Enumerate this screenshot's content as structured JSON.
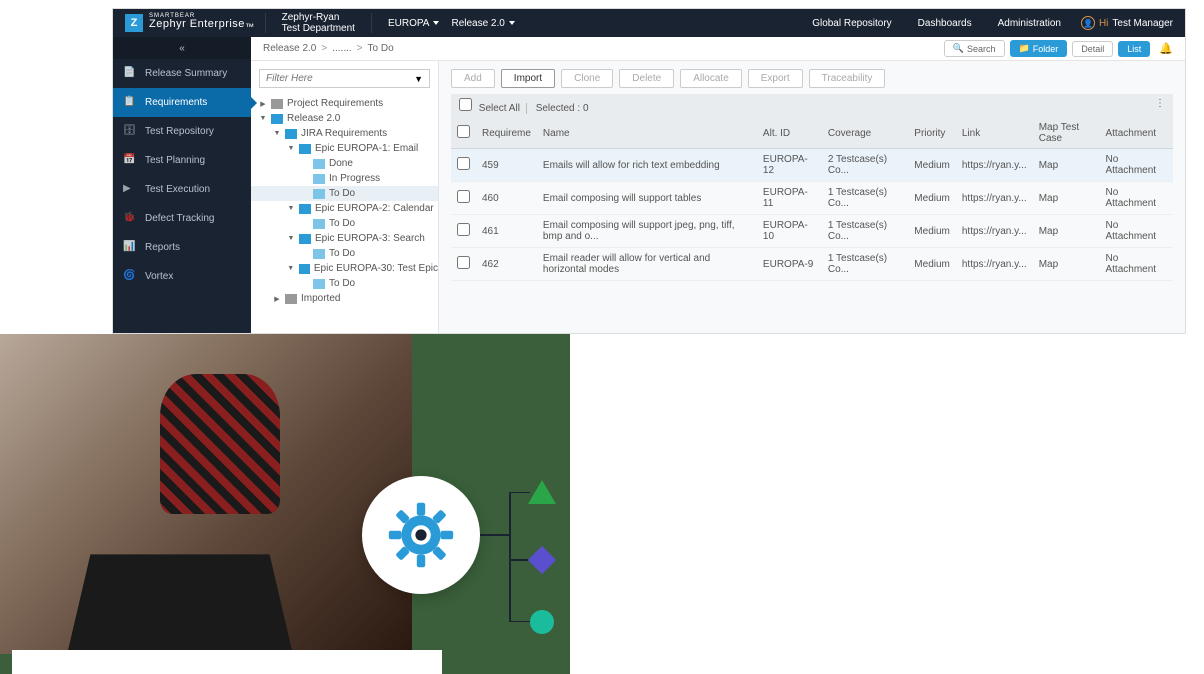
{
  "header": {
    "brand_small": "SMARTBEAR",
    "brand": "Zephyr Enterprise",
    "tm": "™",
    "project_line1": "Zephyr-Ryan",
    "project_line2": "Test Department",
    "nav1": "EUROPA",
    "nav2": "Release 2.0",
    "right": {
      "global": "Global Repository",
      "dash": "Dashboards",
      "admin": "Administration",
      "hi": "Hi",
      "user": "Test Manager"
    }
  },
  "sidebar": {
    "items": [
      {
        "label": "Release Summary",
        "icon": "summary"
      },
      {
        "label": "Requirements",
        "icon": "requirements",
        "active": true
      },
      {
        "label": "Test Repository",
        "icon": "repository"
      },
      {
        "label": "Test Planning",
        "icon": "planning"
      },
      {
        "label": "Test Execution",
        "icon": "execution"
      },
      {
        "label": "Defect Tracking",
        "icon": "defect"
      },
      {
        "label": "Reports",
        "icon": "reports"
      },
      {
        "label": "Vortex",
        "icon": "vortex"
      }
    ]
  },
  "breadcrumb": {
    "a": "Release 2.0",
    "b": ".......",
    "c": "To Do",
    "search": "Search",
    "folder": "Folder",
    "detail": "Detail",
    "list": "List"
  },
  "tree": {
    "filter_placeholder": "Filter Here",
    "n0": "Project Requirements",
    "n1": "Release 2.0",
    "n2": "JIRA Requirements",
    "n3": "Epic EUROPA-1: Email",
    "n3a": "Done",
    "n3b": "In Progress",
    "n3c": "To Do",
    "n4": "Epic EUROPA-2: Calendar",
    "n4a": "To Do",
    "n5": "Epic EUROPA-3: Search",
    "n5a": "To Do",
    "n6": "Epic EUROPA-30: Test Epic",
    "n6a": "To Do",
    "n7": "Imported"
  },
  "actions": {
    "add": "Add",
    "import": "Import",
    "clone": "Clone",
    "delete": "Delete",
    "allocate": "Allocate",
    "export": "Export",
    "trace": "Traceability"
  },
  "table": {
    "select_all": "Select All",
    "selected": "Selected : 0",
    "cols": {
      "req": "Requireme",
      "name": "Name",
      "altid": "Alt. ID",
      "cov": "Coverage",
      "pri": "Priority",
      "link": "Link",
      "map": "Map Test Case",
      "att": "Attachment"
    },
    "rows": [
      {
        "req": "459",
        "name": "Emails will allow for rich text embedding",
        "altid": "EUROPA-12",
        "cov": "2 Testcase(s) Co...",
        "pri": "Medium",
        "link": "https://ryan.y...",
        "map": "Map",
        "att": "No Attachment",
        "hl": true
      },
      {
        "req": "460",
        "name": "Email composing will support tables",
        "altid": "EUROPA-11",
        "cov": "1 Testcase(s) Co...",
        "pri": "Medium",
        "link": "https://ryan.y...",
        "map": "Map",
        "att": "No Attachment"
      },
      {
        "req": "461",
        "name": "Email composing will support jpeg, png, tiff, bmp and o...",
        "altid": "EUROPA-10",
        "cov": "1 Testcase(s) Co...",
        "pri": "Medium",
        "link": "https://ryan.y...",
        "map": "Map",
        "att": "No Attachment"
      },
      {
        "req": "462",
        "name": "Email reader will allow for vertical and horizontal modes",
        "altid": "EUROPA-9",
        "cov": "1 Testcase(s) Co...",
        "pri": "Medium",
        "link": "https://ryan.y...",
        "map": "Map",
        "att": "No Attachment"
      }
    ]
  }
}
